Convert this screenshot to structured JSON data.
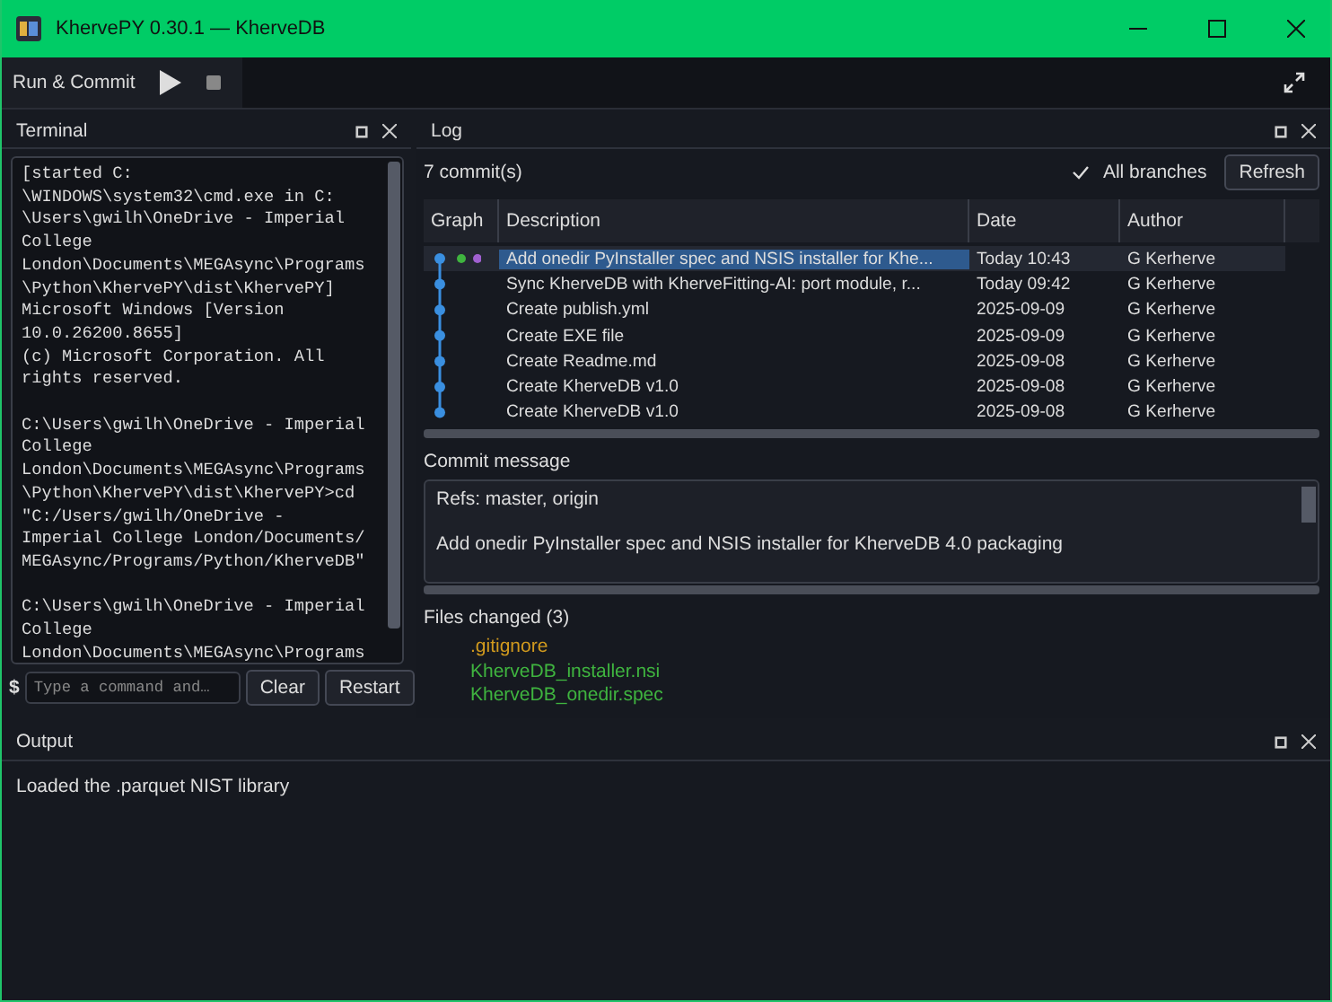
{
  "window": {
    "title": "KhervePY 0.30.1 — KherveDB"
  },
  "toolbar": {
    "label": "Run & Commit"
  },
  "terminal": {
    "title": "Terminal",
    "blocks": [
      [
        "[started C:",
        "\\WINDOWS\\system32\\cmd.exe in C:",
        "\\Users\\gwilh\\OneDrive - Imperial",
        "College",
        "London\\Documents\\MEGAsync\\Programs",
        "\\Python\\KhervePY\\dist\\KhervePY]",
        "Microsoft Windows [Version",
        "10.0.26200.8655]",
        "(c) Microsoft Corporation. All",
        "rights reserved."
      ],
      [
        "C:\\Users\\gwilh\\OneDrive - Imperial",
        "College",
        "London\\Documents\\MEGAsync\\Programs",
        "\\Python\\KhervePY\\dist\\KhervePY>cd",
        "\"C:/Users/gwilh/OneDrive -",
        "Imperial College London/Documents/",
        "MEGAsync/Programs/Python/KherveDB\""
      ],
      [
        "C:\\Users\\gwilh\\OneDrive - Imperial",
        "College",
        "London\\Documents\\MEGAsync\\Programs"
      ]
    ],
    "prompt": "$",
    "placeholder": "Type a command and…",
    "buttons": [
      "Clear",
      "Restart"
    ]
  },
  "log": {
    "title": "Log",
    "count": "7 commit(s)",
    "all_branches": {
      "label": "All branches",
      "checked": true
    },
    "refresh": "Refresh",
    "columns": [
      "Graph",
      "Description",
      "Date",
      "Author"
    ],
    "rows": [
      {
        "description": "Add onedir PyInstaller spec and NSIS installer for Khe...",
        "date": "Today 10:43",
        "author": "G Kerherve",
        "selected": true
      },
      {
        "description": "Sync KherveDB with KherveFitting-AI: port module, r...",
        "date": "Today 09:42",
        "author": "G Kerherve",
        "selected": false
      },
      {
        "description": "Create publish.yml",
        "date": "2025-09-09",
        "author": "G Kerherve",
        "selected": false
      },
      {
        "description": "Create EXE file",
        "date": "2025-09-09",
        "author": "G Kerherve",
        "selected": false
      },
      {
        "description": "Create Readme.md",
        "date": "2025-09-08",
        "author": "G Kerherve",
        "selected": false
      },
      {
        "description": "Create KherveDB v1.0",
        "date": "2025-09-08",
        "author": "G Kerherve",
        "selected": false
      },
      {
        "description": "Create KherveDB v1.0",
        "date": "2025-09-08",
        "author": "G Kerherve",
        "selected": false
      }
    ],
    "commit_message_label": "Commit message",
    "commit_message": [
      "Refs: master, origin",
      "Add onedir PyInstaller spec and NSIS installer for KherveDB 4.0 packaging"
    ],
    "files_label": "Files changed (3)",
    "files": [
      {
        "name": ".gitignore",
        "color": "#d19a1e"
      },
      {
        "name": "KherveDB_installer.nsi",
        "color": "#3fb43f"
      },
      {
        "name": "KherveDB_onedir.spec",
        "color": "#3fb43f"
      }
    ]
  },
  "output": {
    "title": "Output",
    "text": "Loaded the .parquet NIST library"
  }
}
